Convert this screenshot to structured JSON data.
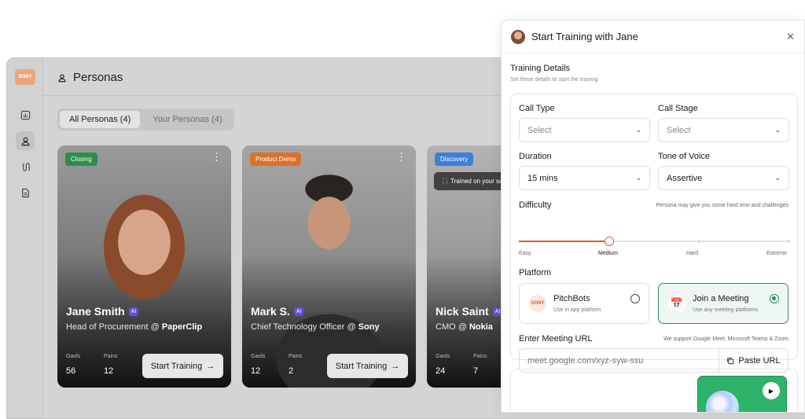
{
  "app": {
    "logo_text": "SONY",
    "page_title": "Personas",
    "tabs": [
      {
        "label": "All Personas (4)"
      },
      {
        "label": "Your Personas (4)"
      }
    ],
    "rail_icons": [
      "chart-icon",
      "user-icon",
      "route-icon",
      "document-icon"
    ]
  },
  "cards": [
    {
      "tag": "Closing",
      "tag_color": "#2f8d4a",
      "name": "Jane Smith",
      "ai": "AI",
      "role": "Head of Procurement @ ",
      "company": "PaperClip",
      "gaols_label": "Gaols",
      "gaols": "56",
      "pains_label": "Pains",
      "pains": "12",
      "button": "Start Training"
    },
    {
      "tag": "Product Demo",
      "tag_color": "#d9722c",
      "name": "Mark S.",
      "ai": "AI",
      "role": "Chief Technology Officer @ ",
      "company": "Sony",
      "gaols_label": "Gaols",
      "gaols": "12",
      "pains_label": "Pains",
      "pains": "2",
      "button": "Start Training"
    },
    {
      "tag": "Discovery",
      "tag_color": "#3d7fd6",
      "name": "Nick Saint",
      "ai": "AI",
      "role": "CMO @ ",
      "company": "Nokia",
      "gaols_label": "Gaols",
      "gaols": "24",
      "pains_label": "Pains",
      "pains": "7",
      "trained": "Trained on your sa"
    }
  ],
  "panel": {
    "title": "Start Training with Jane",
    "section_title": "Training Details",
    "section_sub": "Set these details to start the training",
    "call_type_label": "Call Type",
    "call_type_value": "Select",
    "call_stage_label": "Call Stage",
    "call_stage_value": "Select",
    "duration_label": "Duration",
    "duration_value": "15 mins",
    "tone_label": "Tone of Voice",
    "tone_value": "Assertive",
    "difficulty_label": "Difficulty",
    "difficulty_hint": "Persona may give you some hard time and challenges",
    "difficulty_levels": [
      "Easy",
      "Medium",
      "Hard",
      "Extreme"
    ],
    "difficulty_selected_fraction": 0.333,
    "platform_label": "Platform",
    "platforms": [
      {
        "name": "PitchBots",
        "sub": "Use in app platform",
        "selected": false
      },
      {
        "name": "Join a Meeting",
        "sub": "Use any meeting platforms",
        "selected": true
      }
    ],
    "url_label": "Enter Meeting URL",
    "url_hint": "We support Google Meet, Microsoft Teams & Zoom",
    "url_placeholder": "meet.google.com/xyz-syw-ssu",
    "paste_label": "Paste URL"
  },
  "colors": {
    "accent": "#e05a2a",
    "selected": "#2f8d5a"
  }
}
